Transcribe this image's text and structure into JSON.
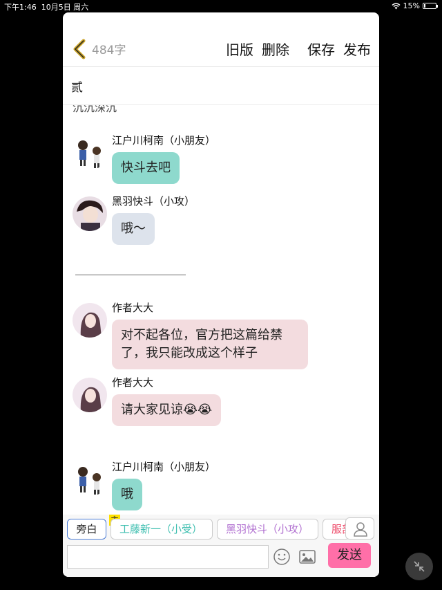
{
  "status": {
    "time": "下午1:46",
    "date": "10月5日 周六",
    "battery": "15%",
    "battery_level": 0.15
  },
  "header": {
    "word_count": "484字",
    "old_version": "旧版",
    "delete": "删除",
    "save": "保存",
    "publish": "发布"
  },
  "doc": {
    "title": "贰"
  },
  "chat": {
    "cutoff_text": "沉沉深沉",
    "messages": [
      {
        "name": "江户川柯南（小朋友）",
        "text": "快斗去吧",
        "bubble_color": "#8ed9cd"
      },
      {
        "name": "黑羽快斗（小攻）",
        "text": "哦～",
        "bubble_color": "#dde3ec"
      },
      {
        "name": "作者大大",
        "text": "对不起各位，官方把这篇给禁了，我只能改成这个样子",
        "bubble_color": "#f3dcdf"
      },
      {
        "name": "作者大大",
        "text": "请大家见谅😭😭",
        "bubble_color": "#f3dcdf"
      },
      {
        "name": "江户川柯南（小朋友）",
        "text": "哦",
        "bubble_color": "#8ed9cd"
      }
    ]
  },
  "roles": {
    "narration": "旁白",
    "main_badge": "主",
    "role1": {
      "label": "工藤新一（小受）",
      "color": "#3fbfb0"
    },
    "role2": {
      "label": "黑羽快斗（小攻）",
      "color": "#b06fd0"
    },
    "role3": {
      "label": "服部",
      "color": "#ee4c6b"
    }
  },
  "input": {
    "placeholder": "",
    "send": "发送"
  }
}
